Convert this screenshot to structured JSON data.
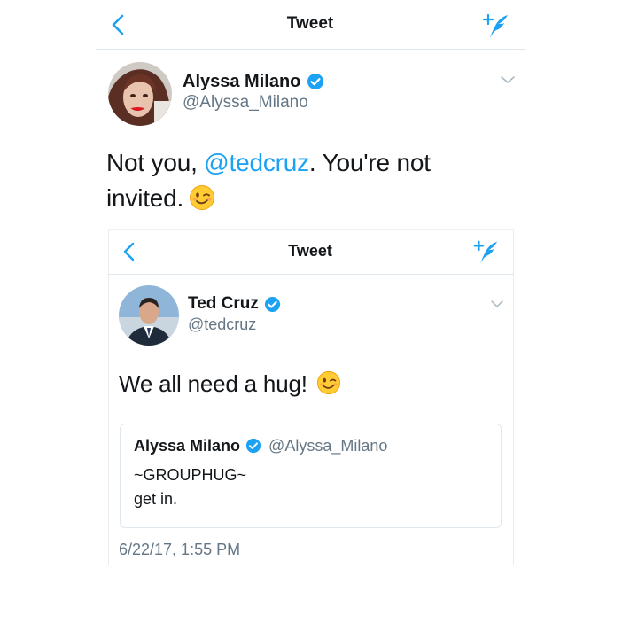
{
  "outer": {
    "nav": {
      "title": "Tweet",
      "back_icon": "chevron-left-icon",
      "compose_icon": "compose-tweet-icon"
    },
    "author": {
      "name": "Alyssa Milano",
      "handle": "@Alyssa_Milano",
      "verified": true
    },
    "body": {
      "prefix": "Not you, ",
      "mention": "@tedcruz",
      "suffix": ". You're not invited.",
      "emoji": "winking-face-emoji"
    }
  },
  "inner": {
    "nav": {
      "title": "Tweet",
      "back_icon": "chevron-left-icon",
      "compose_icon": "compose-tweet-icon"
    },
    "author": {
      "name": "Ted Cruz",
      "handle": "@tedcruz",
      "verified": true
    },
    "body": {
      "text": "We all need a hug!",
      "emoji": "winking-face-emoji"
    },
    "quote": {
      "name": "Alyssa Milano",
      "handle": "@Alyssa_Milano",
      "verified": true,
      "text": "~GROUPHUG~\nget in."
    },
    "timestamp": "6/22/17, 1:55 PM"
  },
  "colors": {
    "twitter_blue": "#1da1f2",
    "verified_blue": "#1da1f2",
    "secondary_text": "#657786",
    "divider": "#e1e8ed"
  }
}
